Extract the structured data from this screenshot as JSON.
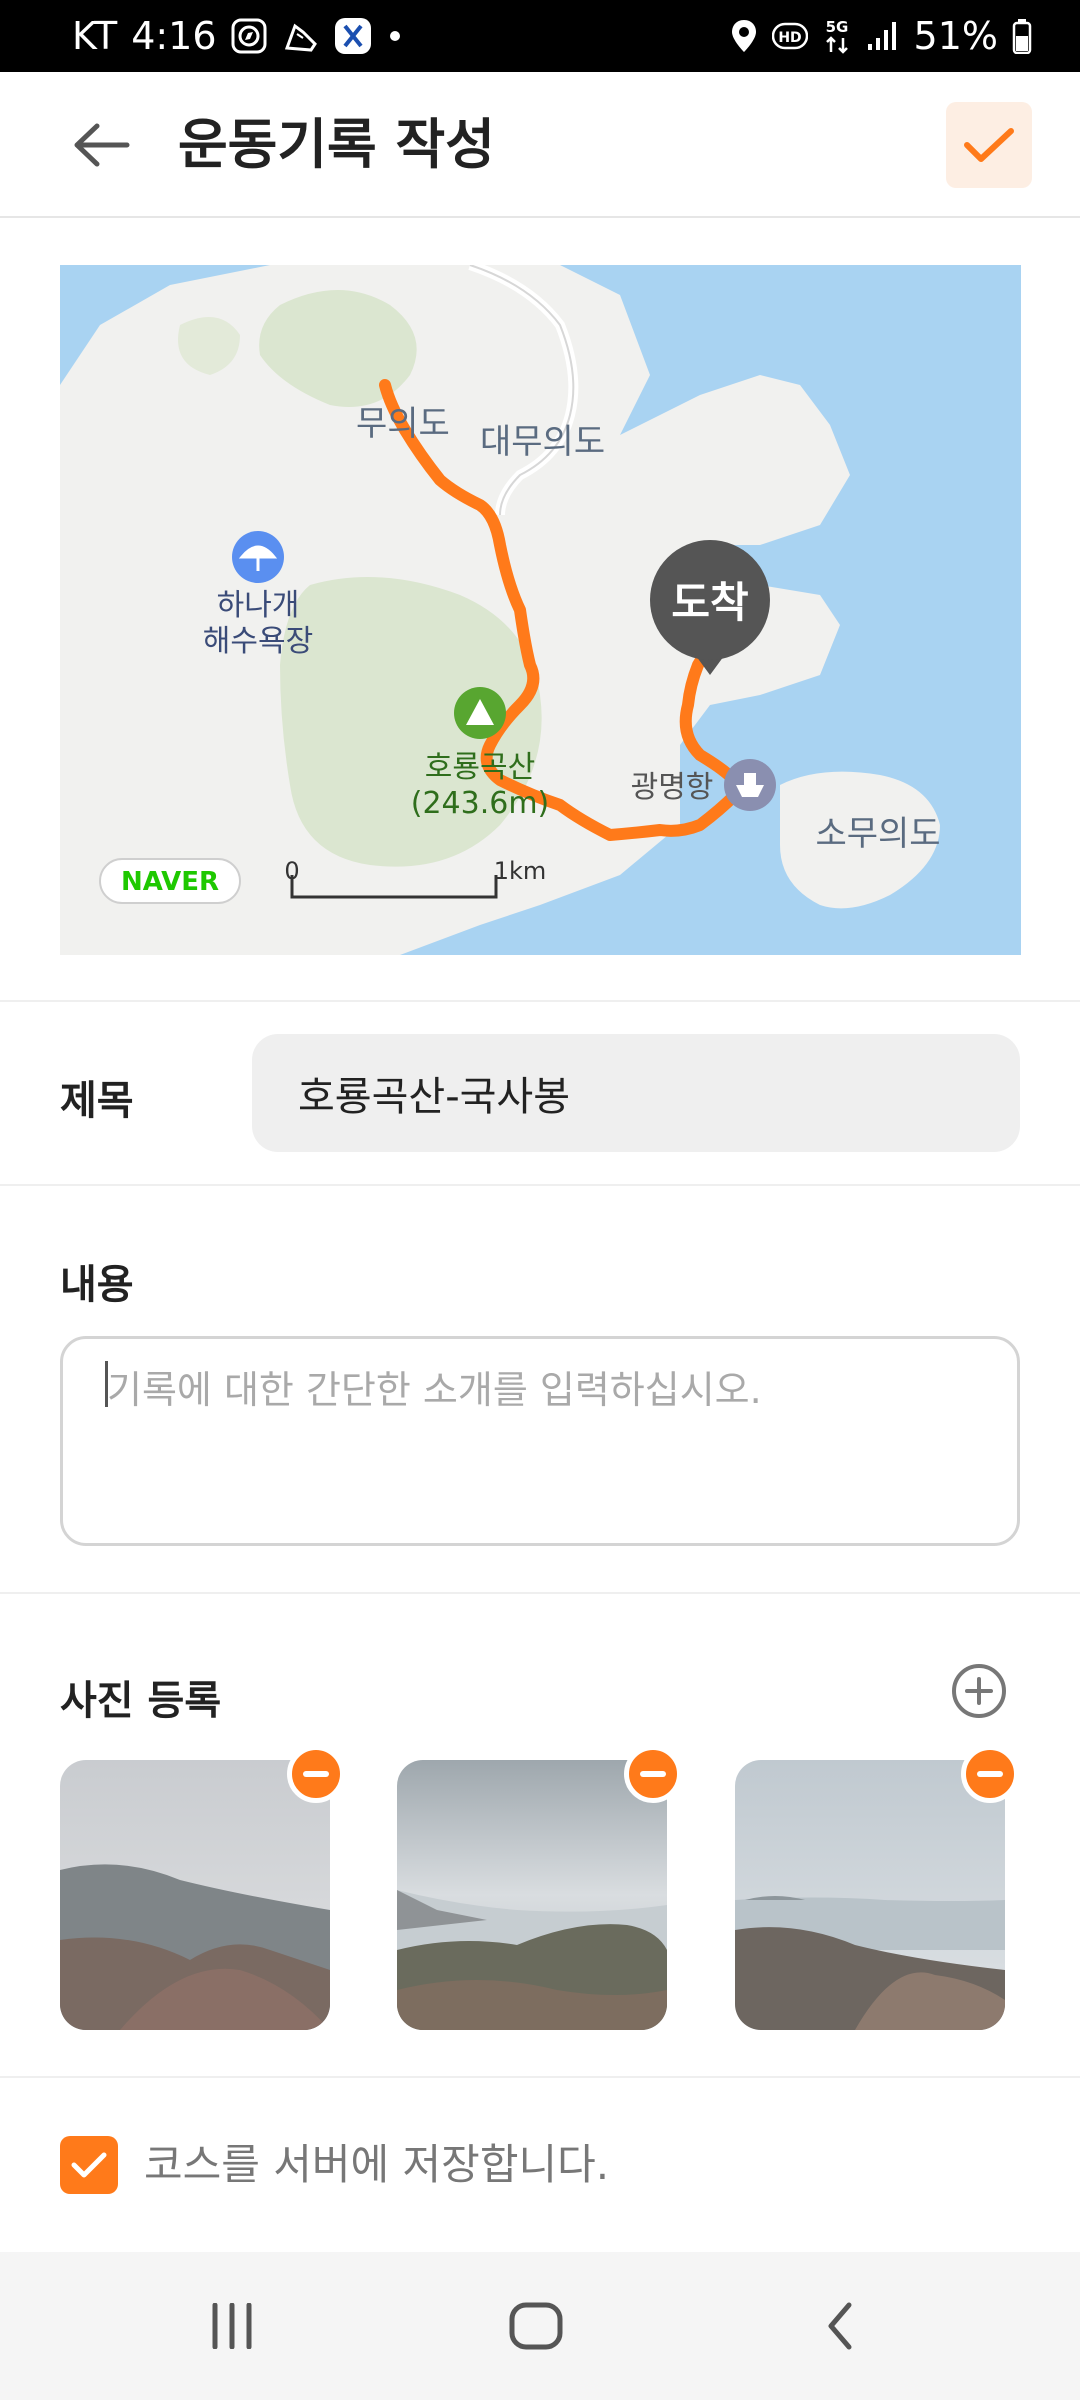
{
  "status_bar": {
    "carrier": "KT",
    "time": "4:16",
    "left_icons": [
      "compass-icon",
      "shoe-icon",
      "x-app-icon",
      "dot-icon"
    ],
    "right_icons": [
      "location-icon",
      "hd-icon",
      "5g-icon",
      "signal-icon",
      "battery-icon"
    ],
    "battery": "51%"
  },
  "header": {
    "title": "운동기록 작성",
    "back_icon": "arrow-left-icon",
    "confirm_icon": "check-icon",
    "accent_color": "#ff7a1a"
  },
  "map": {
    "labels": {
      "island1": "무의도",
      "island2": "대무의도",
      "beach_line1": "하나개",
      "beach_line2": "해수욕장",
      "mountain_name": "호룡곡산",
      "mountain_height": "(243.6m)",
      "port": "광명항",
      "island3": "소무의도",
      "arrival": "도착",
      "brand": "NAVER",
      "scale_zero": "0",
      "scale_max": "1km"
    },
    "route_color": "#ff7a1a",
    "water_color": "#a9d3f2"
  },
  "form": {
    "title_label": "제목",
    "title_value": "호룡곡산-국사봉",
    "content_label": "내용",
    "content_placeholder": "기록에 대한 간단한 소개를 입력하십시오.",
    "photos_label": "사진 등록",
    "photos": [
      {
        "name": "photo-1",
        "scene": "hazy mountain ridge"
      },
      {
        "name": "photo-2",
        "scene": "sea and hills"
      },
      {
        "name": "photo-3",
        "scene": "coast with bare trees"
      }
    ],
    "save_course_checked": true,
    "save_course_label": "코스를 서버에 저장합니다."
  },
  "nav_bar": {
    "buttons": [
      "recent-apps-icon",
      "home-icon",
      "back-icon"
    ]
  }
}
